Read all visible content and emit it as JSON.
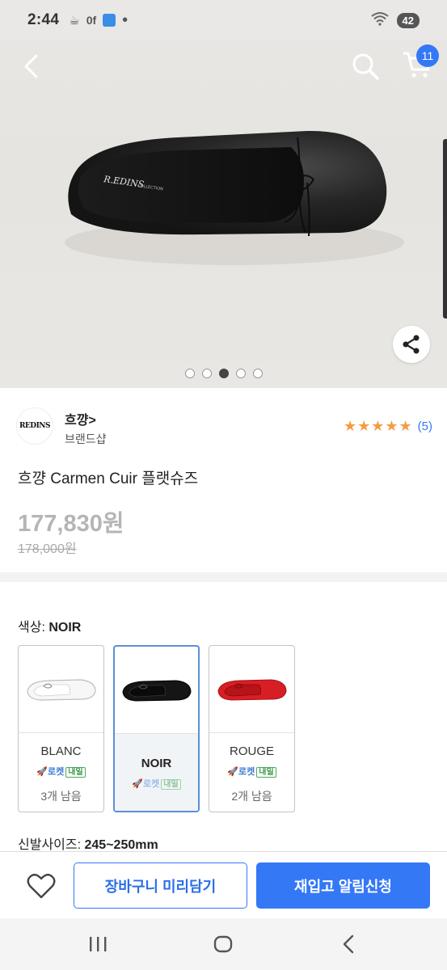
{
  "status_bar": {
    "time": "2:44",
    "battery": "42",
    "left_icons": [
      "coffee-icon",
      "nfc-icon",
      "app-icon"
    ]
  },
  "header": {
    "cart_count": "11"
  },
  "gallery": {
    "image_count": 5,
    "active_index": 2
  },
  "brand": {
    "logo_text": "REDINS",
    "name": "흐꺙>",
    "subtitle": "브랜드샵"
  },
  "rating": {
    "stars": 5,
    "count": "(5)"
  },
  "product": {
    "title": "흐꺙 Carmen Cuir 플랫슈즈",
    "price": "177,830원",
    "original_price": "178,000원"
  },
  "options": {
    "color_label": "색상:",
    "color_value": "NOIR",
    "swatches": [
      {
        "name": "BLANC",
        "rocket": "로켓",
        "next": "내일",
        "stock": "3개 남음",
        "color": "#f4f4f4"
      },
      {
        "name": "NOIR",
        "rocket": "로켓",
        "next": "내일",
        "stock": "",
        "color": "#1a1a1a"
      },
      {
        "name": "ROUGE",
        "rocket": "로켓",
        "next": "내일",
        "stock": "2개 남음",
        "color": "#d81e25"
      }
    ],
    "size_label": "신발사이즈:",
    "size_value": "245~250mm"
  },
  "actions": {
    "cart_button": "장바구니 미리담기",
    "restock_button": "재입고 알림신청"
  },
  "colors": {
    "accent": "#3478f6",
    "star": "#f39c42",
    "rocket_green": "#3c9a4a"
  }
}
